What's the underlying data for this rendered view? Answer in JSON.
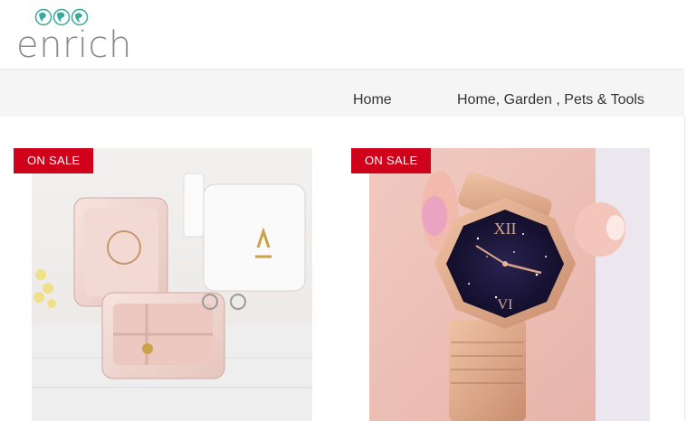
{
  "brand": {
    "logo_text": "enrich"
  },
  "nav": {
    "items": [
      {
        "label": "Home"
      },
      {
        "label": "Home, Garden , Pets & Tools"
      }
    ]
  },
  "products": [
    {
      "badge": "ON SALE",
      "image": "jewelry-box-image"
    },
    {
      "badge": "ON SALE",
      "image": "starry-watch-image"
    }
  ],
  "colors": {
    "badge_bg": "#d0021b",
    "nav_bg": "#f5f5f5",
    "logo_globe": "#3aa89b",
    "logo_text": "#8a8a8a"
  }
}
